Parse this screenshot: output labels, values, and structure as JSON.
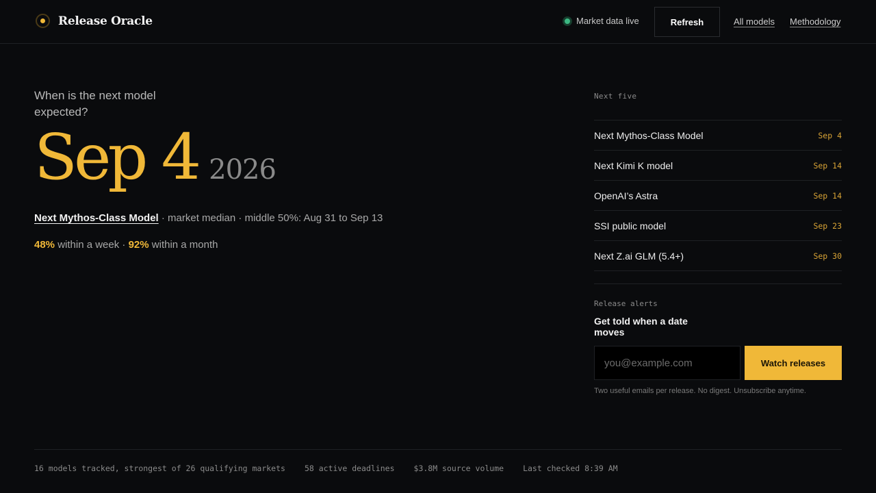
{
  "header": {
    "brand": "Release Oracle",
    "status": "Market data live",
    "refresh_label": "Refresh",
    "nav": [
      "All models",
      "Methodology"
    ]
  },
  "hero": {
    "question": "When is the next model expected?",
    "date_month_day": "Sep 4",
    "date_year": "2026",
    "model_name": "Next Mythos-Class Model",
    "detail": " · market median · middle 50%: Aug 31 to Sep 13",
    "week_pct": "48%",
    "week_text": " within a week · ",
    "month_pct": "92%",
    "month_text": " within a month"
  },
  "next_five": {
    "label": "Next five",
    "items": [
      {
        "name": "Next Mythos-Class Model",
        "date": "Sep 4"
      },
      {
        "name": "Next Kimi K model",
        "date": "Sep 14"
      },
      {
        "name": "OpenAI’s Astra",
        "date": "Sep 14"
      },
      {
        "name": "SSI public model",
        "date": "Sep 23"
      },
      {
        "name": "Next Z.ai GLM (5.4+)",
        "date": "Sep 30"
      }
    ]
  },
  "alerts": {
    "label": "Release alerts",
    "title": "Get told when a date moves",
    "email_placeholder": "you@example.com",
    "button_label": "Watch releases",
    "fineprint": "Two useful emails per release. No digest. Unsubscribe anytime."
  },
  "stats": [
    "16 models tracked, strongest of 26 qualifying markets",
    "58 active deadlines",
    "$3.8M source volume",
    "Last checked 8:39 AM"
  ],
  "colors": {
    "accent": "#f0b838",
    "live": "#3cb883",
    "background": "#0a0b0d"
  }
}
